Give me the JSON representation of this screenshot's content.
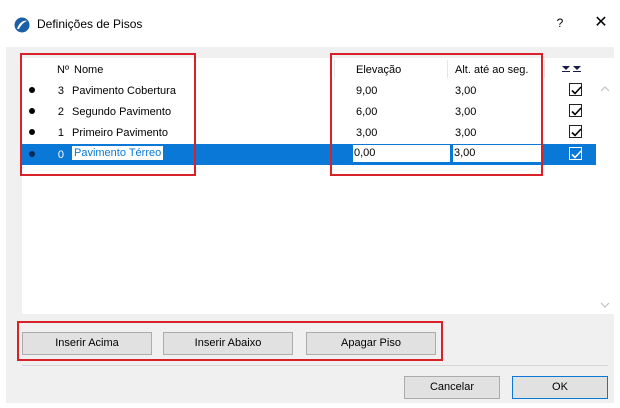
{
  "window": {
    "title": "Definições de Pisos",
    "help_label": "?",
    "close_label": "✕"
  },
  "table": {
    "headers": {
      "number": "Nº",
      "name": "Nome",
      "elevation": "Elevação",
      "height_next": "Alt. até ao seg."
    },
    "rows": [
      {
        "number": "3",
        "name": "Pavimento Cobertura",
        "elevation": "9,00",
        "height_next": "3,00",
        "checked": true,
        "selected": false
      },
      {
        "number": "2",
        "name": "Segundo Pavimento",
        "elevation": "6,00",
        "height_next": "3,00",
        "checked": true,
        "selected": false
      },
      {
        "number": "1",
        "name": "Primeiro Pavimento",
        "elevation": "3,00",
        "height_next": "3,00",
        "checked": true,
        "selected": false
      },
      {
        "number": "0",
        "name": "Pavimento Térreo",
        "elevation": "0,00",
        "height_next": "3,00",
        "checked": true,
        "selected": true
      }
    ]
  },
  "buttons": {
    "insert_above": "Inserir Acima",
    "insert_below": "Inserir Abaixo",
    "delete_floor": "Apagar Piso",
    "cancel": "Cancelar",
    "ok": "OK"
  },
  "colors": {
    "selection": "#0a78d7",
    "highlight_box": "#d9212a"
  },
  "icons": {
    "app": "archicad-logo-icon",
    "sort": "double-chevron-down-icon",
    "scroll_up": "chevron-up-icon",
    "scroll_down": "chevron-down-icon"
  }
}
